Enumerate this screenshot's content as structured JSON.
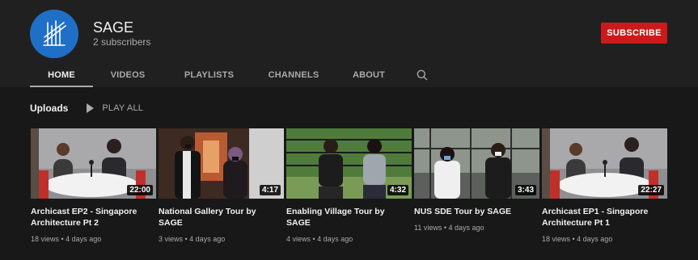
{
  "channel": {
    "name": "SAGE",
    "subscribers": "2 subscribers",
    "subscribe_label": "SUBSCRIBE",
    "avatar_icon": "building-logo-icon"
  },
  "tabs": [
    {
      "label": "HOME",
      "active": true
    },
    {
      "label": "VIDEOS",
      "active": false
    },
    {
      "label": "PLAYLISTS",
      "active": false
    },
    {
      "label": "CHANNELS",
      "active": false
    },
    {
      "label": "ABOUT",
      "active": false
    }
  ],
  "uploads": {
    "title": "Uploads",
    "play_all_label": "PLAY ALL"
  },
  "videos": [
    {
      "title": "Archicast EP2 - Singapore Architecture Pt 2",
      "duration": "22:00",
      "views": "18 views",
      "age": "4 days ago"
    },
    {
      "title": "National Gallery Tour by SAGE",
      "duration": "4:17",
      "views": "3 views",
      "age": "4 days ago"
    },
    {
      "title": "Enabling Village Tour by SAGE",
      "duration": "4:32",
      "views": "4 views",
      "age": "4 days ago"
    },
    {
      "title": "NUS SDE Tour by SAGE",
      "duration": "3:43",
      "views": "11 views",
      "age": "4 days ago"
    },
    {
      "title": "Archicast EP1 - Singapore Architecture Pt 1",
      "duration": "22:27",
      "views": "18 views",
      "age": "4 days ago"
    }
  ],
  "colors": {
    "background": "#181818",
    "header": "#202020",
    "subscribe": "#cc1a1a",
    "avatar": "#1f6fc6"
  }
}
